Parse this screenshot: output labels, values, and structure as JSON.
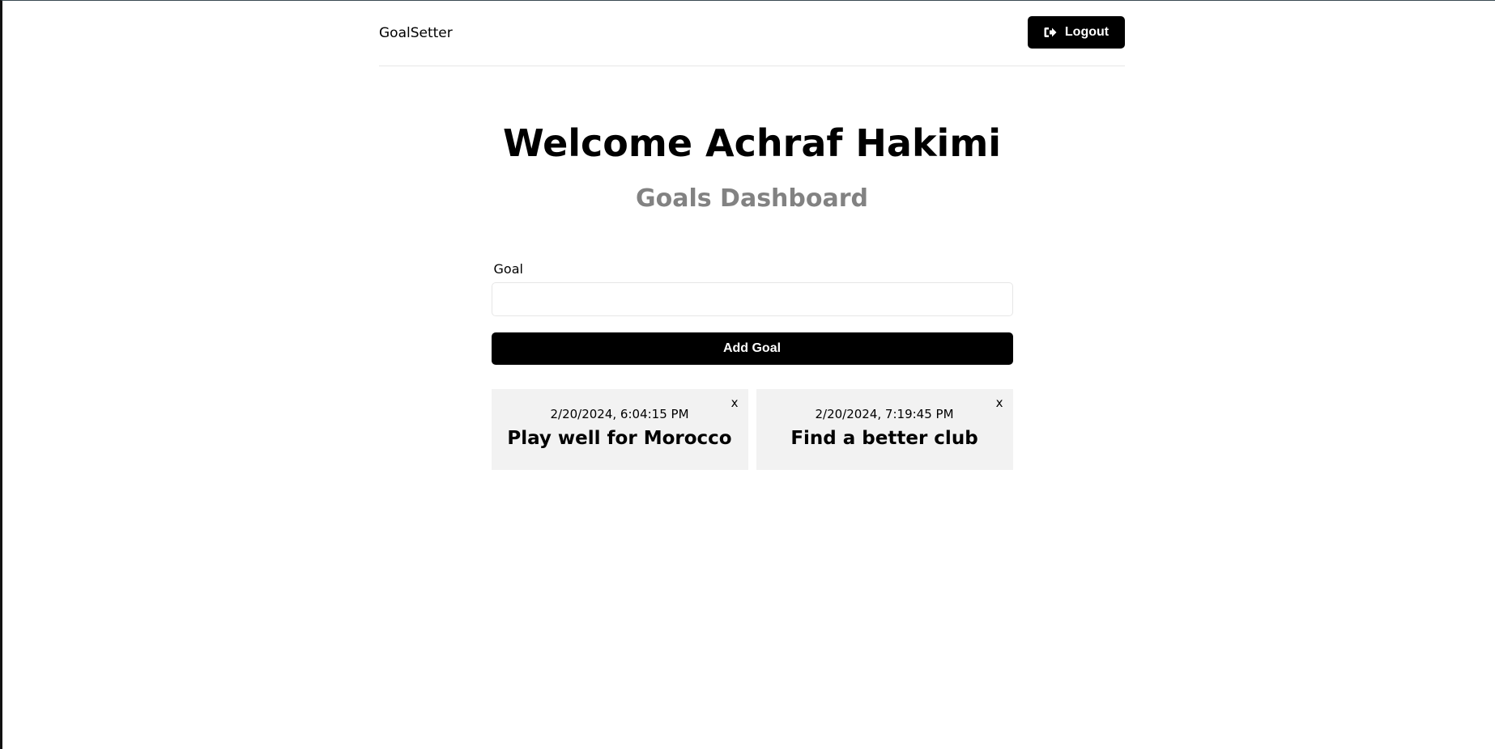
{
  "header": {
    "logo": "GoalSetter",
    "logout_label": "Logout"
  },
  "heading": {
    "welcome": "Welcome Achraf Hakimi",
    "subtitle": "Goals Dashboard"
  },
  "form": {
    "label": "Goal",
    "input_value": "",
    "submit_label": "Add Goal"
  },
  "goals": [
    {
      "date": "2/20/2024, 6:04:15 PM",
      "text": "Play well for Morocco",
      "delete_label": "x"
    },
    {
      "date": "2/20/2024, 7:19:45 PM",
      "text": "Find a better club",
      "delete_label": "x"
    }
  ],
  "colors": {
    "primary": "#000000",
    "subtitle": "#828282",
    "card_background": "#f2f2f2"
  },
  "icons": {
    "logout": "sign-out-icon"
  }
}
